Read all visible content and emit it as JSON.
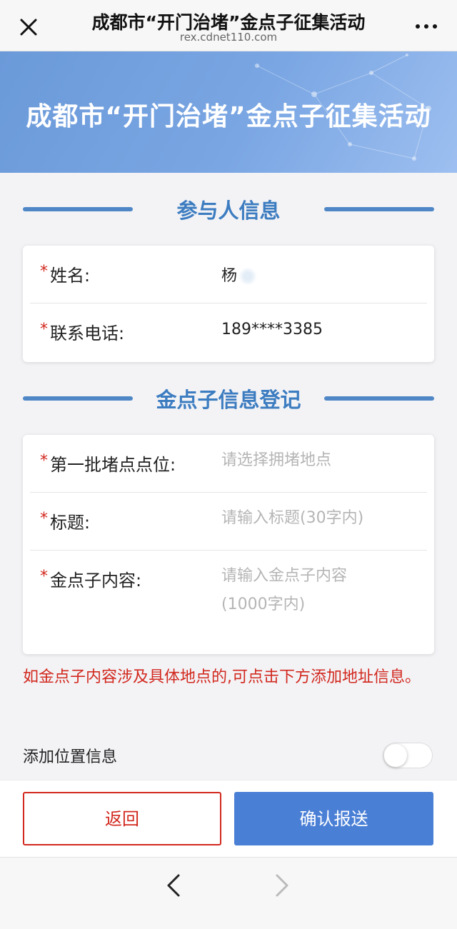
{
  "navbar": {
    "title": "成都市“开门治堵”金点子征集活动",
    "url": "rex.cdnet110.com",
    "close_icon": "close-icon",
    "more_icon": "more-icon"
  },
  "banner": {
    "title": "成都市“开门治堵”金点子征集活动"
  },
  "participant": {
    "heading": "参与人信息",
    "name_label": "姓名:",
    "name_value": "杨",
    "phone_label": "联系电话:",
    "phone_value": "189****3385",
    "required_mark": "*"
  },
  "idea": {
    "heading": "金点子信息登记",
    "location_label": "第一批堵点点位:",
    "location_placeholder": "请选择拥堵地点",
    "title_label": "标题:",
    "title_placeholder": "请输入标题(30字内)",
    "content_label": "金点子内容:",
    "content_placeholder_line1": "请输入金点子内容",
    "content_placeholder_line2": "(1000字内)",
    "required_mark": "*"
  },
  "notice": "如金点子内容涉及具体地点的,可点击下方添加地址信息。",
  "location_toggle": {
    "label": "添加位置信息",
    "enabled": false
  },
  "buttons": {
    "back": "返回",
    "submit": "确认报送"
  },
  "colors": {
    "accent": "#4a7fd6",
    "heading": "#3c7cc0",
    "required": "#d2281e"
  }
}
